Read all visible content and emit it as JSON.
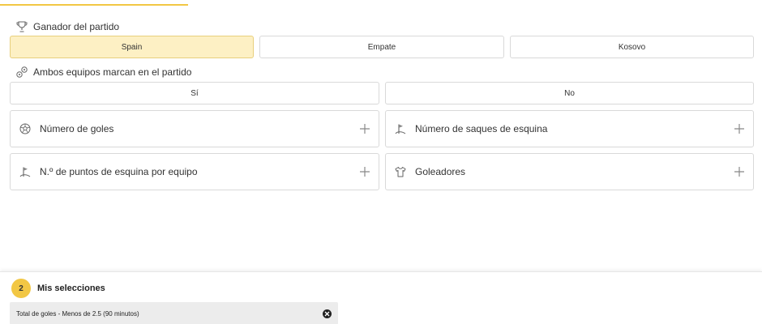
{
  "markets": {
    "match_winner": {
      "title": "Ganador del partido",
      "icon": "trophy-icon",
      "options": [
        "Spain",
        "Empate",
        "Kosovo"
      ],
      "selected": "Spain"
    },
    "both_score": {
      "title": "Ambos equipos marcan en el partido",
      "icon": "balls-icon",
      "options": [
        "Sí",
        "No"
      ]
    },
    "collapsed": [
      {
        "label": "Número de goles",
        "icon": "soccer-ball-icon"
      },
      {
        "label": "Número de saques de esquina",
        "icon": "corner-flag-icon"
      },
      {
        "label": "N.º de puntos de esquina por equipo",
        "icon": "corner-flag-icon"
      },
      {
        "label": "Goleadores",
        "icon": "jersey-icon"
      }
    ]
  },
  "betslip": {
    "count": "2",
    "title": "Mis selecciones",
    "selection": "Total de goles - Menos de 2.5 (90 minutos)"
  },
  "colors": {
    "accent": "#f2c744",
    "selected_bg": "#fdf0c4"
  }
}
